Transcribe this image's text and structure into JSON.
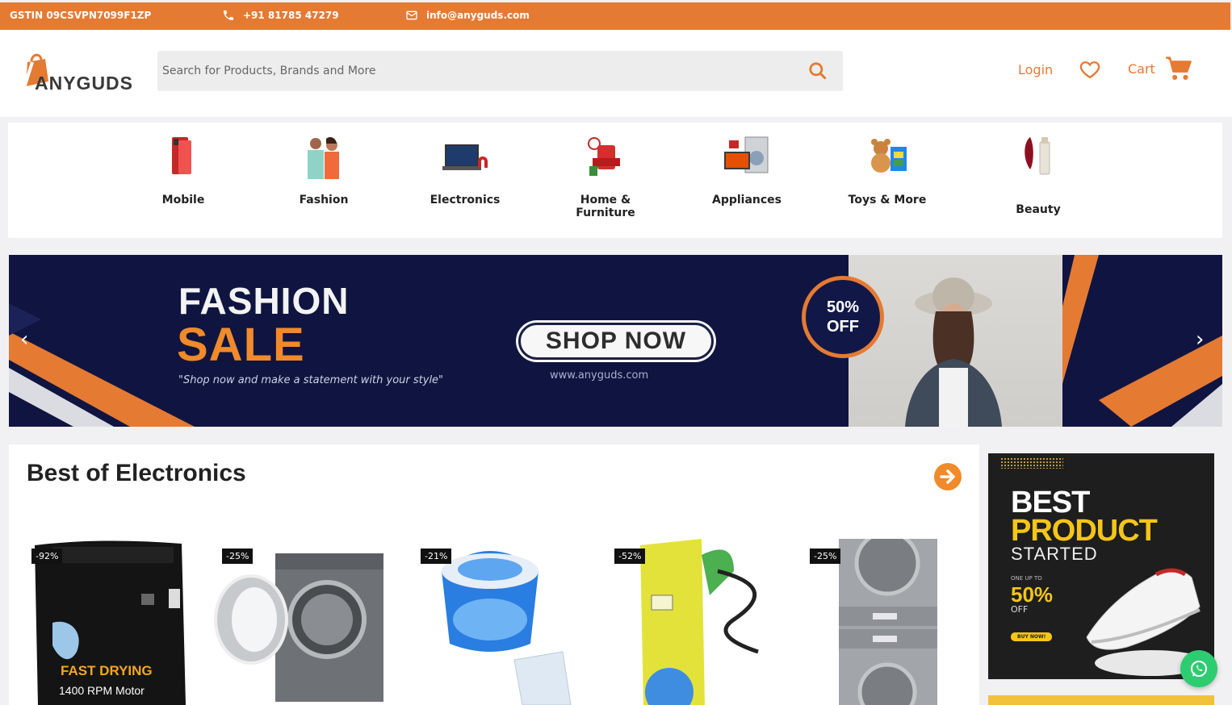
{
  "topbar": {
    "gstin": "GSTIN 09CSVPN7099F1ZP",
    "phone": "+91 81785 47279",
    "email": "info@anyguds.com",
    "bg_color": "#e57a33"
  },
  "header": {
    "logo_text": "ANYGUDS",
    "search_placeholder": "Search for Products, Brands and More",
    "login_label": "Login",
    "cart_label": "Cart",
    "accent_color": "#e57a33",
    "icons": [
      "search-icon",
      "heart-icon",
      "cart-icon"
    ]
  },
  "categories": [
    {
      "label": "Mobile"
    },
    {
      "label": "Fashion"
    },
    {
      "label": "Electronics"
    },
    {
      "label": "Home & Furniture"
    },
    {
      "label": "Appliances"
    },
    {
      "label": "Toys & More"
    },
    {
      "label": "Beauty"
    }
  ],
  "banner": {
    "title_line1": "FASHION",
    "title_line2": "SALE",
    "tagline": "\"Shop now and make a statement with your style\"",
    "cta_label": "SHOP NOW",
    "url": "www.anyguds.com",
    "offer_line1": "50%",
    "offer_line2": "OFF",
    "prev_icon": "chevron-left-icon",
    "next_icon": "chevron-right-icon"
  },
  "electronics": {
    "title": "Best of Electronics",
    "next_icon": "arrow-right-circle-icon",
    "products": [
      {
        "discount": "-92%",
        "overlay_line1": "FAST DRYING",
        "overlay_line2": "1400 RPM Motor"
      },
      {
        "discount": "-25%"
      },
      {
        "discount": "-21%"
      },
      {
        "discount": "-52%"
      },
      {
        "discount": "-25%"
      }
    ]
  },
  "promo": {
    "line1": "BEST",
    "line2": "PRODUCT",
    "line3": "STARTED",
    "small": "ONE UP TO",
    "percent": "50%",
    "off": "OFF",
    "button": "BUY NOW!"
  },
  "whatsapp_icon": "whatsapp-icon"
}
